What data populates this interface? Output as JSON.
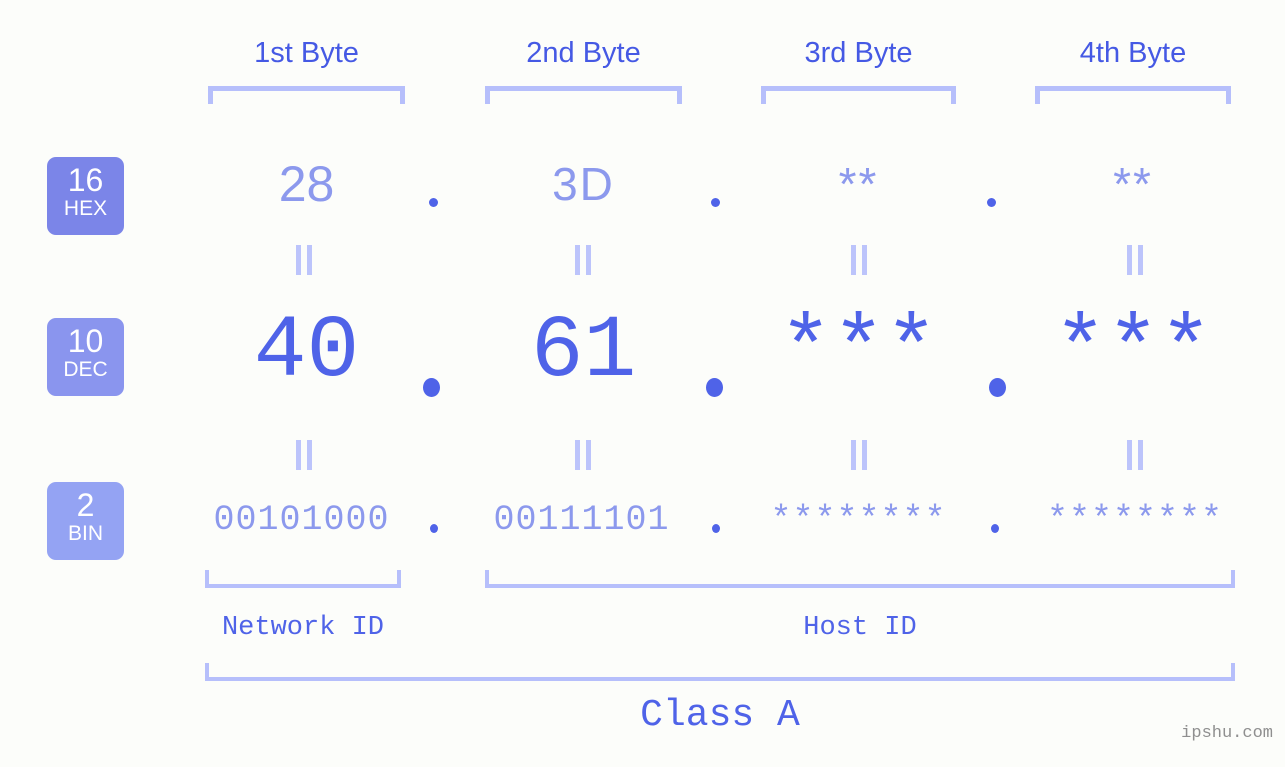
{
  "background_color": "#fcfdfa",
  "accent_color": "#4f63e8",
  "muted_accent_color": "#8c99ed",
  "bracket_color": "#b6bffb",
  "headers": [
    {
      "label": "1st Byte"
    },
    {
      "label": "2nd Byte"
    },
    {
      "label": "3rd Byte"
    },
    {
      "label": "4th Byte"
    }
  ],
  "bases": [
    {
      "id": "hex",
      "number": "16",
      "abbr": "HEX",
      "color": "#7b85e8"
    },
    {
      "id": "dec",
      "number": "10",
      "abbr": "DEC",
      "color": "#8a95ee"
    },
    {
      "id": "bin",
      "number": "2",
      "abbr": "BIN",
      "color": "#94a3f3"
    }
  ],
  "rows": {
    "hex": {
      "bytes": [
        "28",
        "3D",
        "**",
        "**"
      ]
    },
    "dec": {
      "bytes": [
        "40",
        "61",
        "***",
        "***"
      ]
    },
    "bin": {
      "bytes": [
        "00101000",
        "00111101",
        "********",
        "********"
      ]
    }
  },
  "separator": ".",
  "equals_symbol": "=",
  "segments": {
    "network_id": "Network ID",
    "host_id": "Host ID"
  },
  "class_label": "Class A",
  "watermark": "ipshu.com"
}
